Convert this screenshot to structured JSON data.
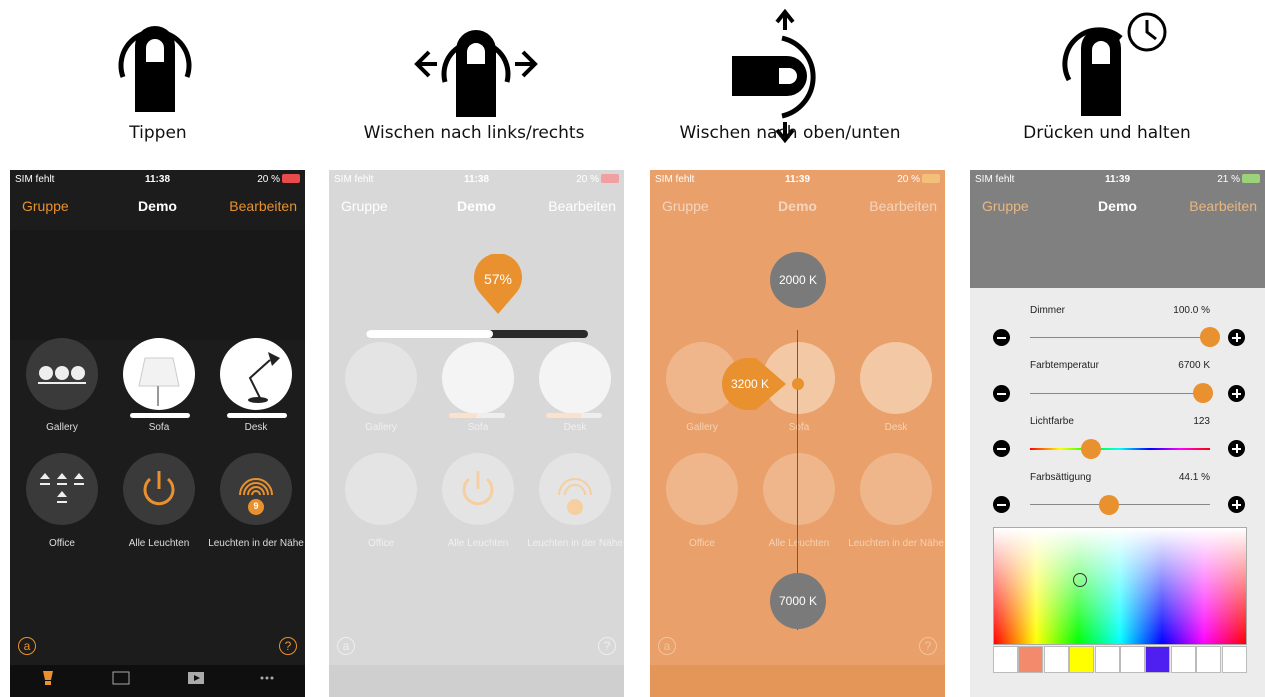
{
  "gestures": [
    {
      "caption": "Tippen"
    },
    {
      "caption": "Wischen nach links/rechts"
    },
    {
      "caption": "Wischen nach oben/unten"
    },
    {
      "caption": "Drücken und halten"
    }
  ],
  "status": {
    "carrier": "SIM fehlt",
    "times": [
      "11:38",
      "11:38",
      "11:39",
      "11:39"
    ],
    "battery": [
      "20 %",
      "20 %",
      "20 %",
      "21 %"
    ]
  },
  "nav": {
    "left": "Gruppe",
    "title": "Demo",
    "right": "Bearbeiten"
  },
  "tiles": {
    "gallery": "Gallery",
    "sofa": "Sofa",
    "desk": "Desk",
    "office": "Office",
    "all": "Alle Leuchten",
    "nearby": "Leuchten in der Nähe",
    "nearby_count": "9"
  },
  "corner": {
    "left": "a",
    "right": "?"
  },
  "swipe_lr": {
    "percent": "57%",
    "level": 0.57
  },
  "swipe_ud": {
    "top": "2000 K",
    "current": "3200 K",
    "bottom": "7000 K"
  },
  "settings": {
    "dimmer": {
      "label": "Dimmer",
      "value": "100.0 %",
      "level": 1.0
    },
    "temp": {
      "label": "Farbtemperatur",
      "value": "6700 K",
      "level": 0.96
    },
    "color": {
      "label": "Lichtfarbe",
      "value": "123",
      "level": 0.34
    },
    "saturation": {
      "label": "Farbsättigung",
      "value": "44.1 %",
      "level": 0.44
    }
  },
  "swatches": [
    "#ffffff",
    "#f48a6c",
    "#ffffff",
    "#ffff00",
    "#ffffff",
    "#ffffff",
    "#4f1ef0",
    "#ffffff",
    "#ffffff",
    "#ffffff"
  ],
  "colors": {
    "accent": "#e8912e",
    "dark_bg": "#1c1c1c",
    "tile_bg": "#3a3a3a"
  }
}
